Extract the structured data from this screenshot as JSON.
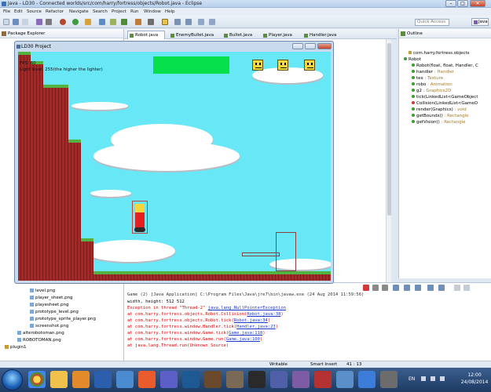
{
  "window": {
    "title": "Java - LD30 - Connected worlds/src/com/harry/fortress/objects/Robot.java - Eclipse"
  },
  "menu": [
    "File",
    "Edit",
    "Source",
    "Refactor",
    "Navigate",
    "Search",
    "Project",
    "Run",
    "Window",
    "Help"
  ],
  "toolbar": {
    "quick_access": "Quick Access",
    "perspective": "Java"
  },
  "package_explorer": {
    "title": "Package Explorer",
    "items": [
      "level.png",
      "player_sheet.png",
      "playesheet.png",
      "prototype_level.png",
      "prototype_sprite_player.png",
      "screenshot.png",
      "alterobotoman.png",
      "ROBOTOMAN.png",
      "plugin1"
    ]
  },
  "editor_tabs": [
    {
      "label": "Robot.java",
      "active": true
    },
    {
      "label": "EnemyBullet.java",
      "active": false
    },
    {
      "label": "Bullet.java",
      "active": false
    },
    {
      "label": "Player.java",
      "active": false
    },
    {
      "label": "Handler.java",
      "active": false
    }
  ],
  "outline": {
    "title": "Outline",
    "package": "com.harry.fortress.objects",
    "class": "Robot",
    "members": [
      {
        "name": "Robot(float, float, Handler, C",
        "type": "",
        "color": "#3f9a36"
      },
      {
        "name": "handler",
        "type": " : Handler",
        "color": "#3f9a36"
      },
      {
        "name": "tex",
        "type": " : Texture",
        "color": "#3f9a36"
      },
      {
        "name": "robo",
        "type": " : Animation",
        "color": "#3f9a36"
      },
      {
        "name": "g2",
        "type": " : Graphics2D",
        "color": "#3f9a36"
      },
      {
        "name": "tick(LinkedList<GameObject",
        "type": "",
        "color": "#3f9a36"
      },
      {
        "name": "Collision(LinkedList<GameO",
        "type": "",
        "color": "#d23a3a"
      },
      {
        "name": "render(Graphics)",
        "type": " : void",
        "color": "#3f9a36"
      },
      {
        "name": "getBounds()",
        "type": " : Rectangle",
        "color": "#3f9a36"
      },
      {
        "name": "getVision()",
        "type": " : Rectangle",
        "color": "#3f9a36"
      }
    ]
  },
  "game_window": {
    "title": "LD30 Project",
    "overlay_fps": "FPS: 60",
    "overlay_light": "Light level: 255(the higher the lighter)"
  },
  "console": {
    "header": "Game (2) [Java Application] C:\\Program Files\\Java\\jre7\\bin\\javaw.exe (24 Aug 2014 11:59:56)",
    "lines": [
      {
        "text": "width, height: 512 512",
        "kind": "normal",
        "link": ""
      },
      {
        "text": "Exception in thread \"Thread-2\" ",
        "kind": "err",
        "link": "java.lang.NullPointerException"
      },
      {
        "text": "        at com.harry.fortress.objects.Robot.Collision(",
        "kind": "err",
        "link": "Robot.java:38",
        "tail": ")"
      },
      {
        "text": "        at com.harry.fortress.objects.Robot.tick(",
        "kind": "err",
        "link": "Robot.java:34",
        "tail": ")"
      },
      {
        "text": "        at com.harry.fortress.window.Handler.tick(",
        "kind": "err",
        "link": "Handler.java:23",
        "tail": ")"
      },
      {
        "text": "        at com.harry.fortress.window.Game.tick(",
        "kind": "err",
        "link": "Game.java:118",
        "tail": ")"
      },
      {
        "text": "        at com.harry.fortress.window.Game.run(",
        "kind": "err",
        "link": "Game.java:100",
        "tail": ")"
      },
      {
        "text": "        at java.lang.Thread.run(Unknown Source)",
        "kind": "err",
        "link": ""
      }
    ]
  },
  "status": {
    "writable": "Writable",
    "insert": "Smart Insert",
    "position": "41 : 13"
  },
  "taskbar": {
    "lang": "EN",
    "time": "12:00",
    "date": "24/08/2014"
  }
}
